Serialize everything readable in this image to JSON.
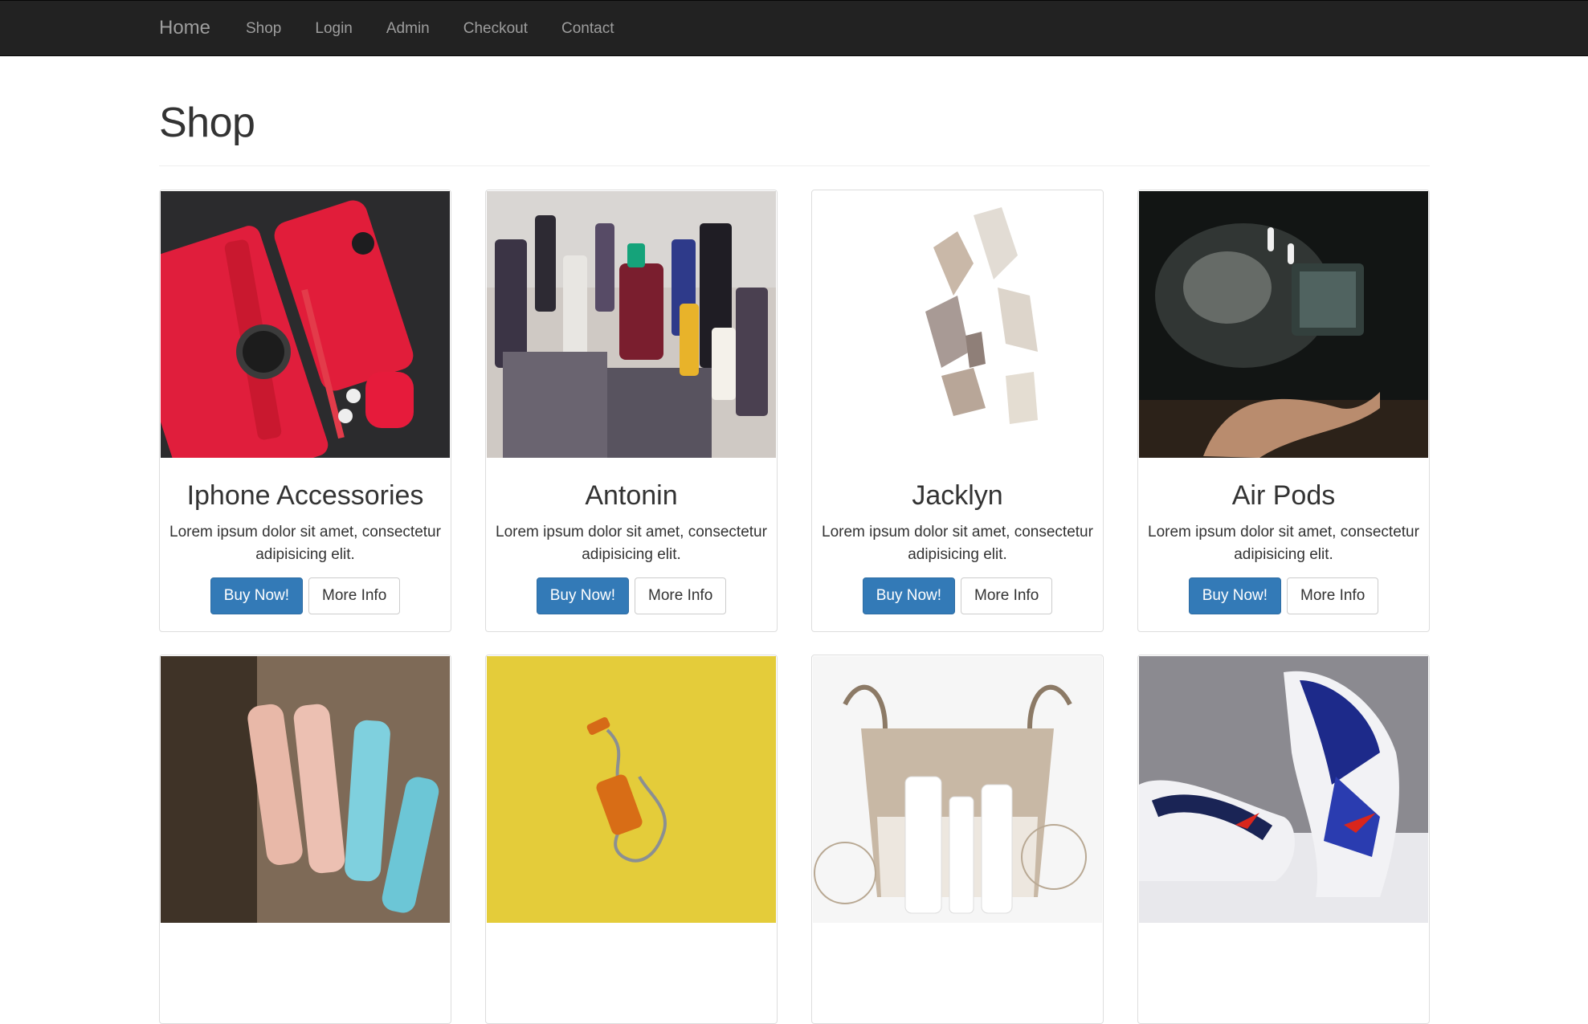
{
  "nav": {
    "brand": "Home",
    "links": [
      "Shop",
      "Login",
      "Admin",
      "Checkout",
      "Contact"
    ]
  },
  "page": {
    "title": "Shop"
  },
  "products": [
    {
      "name": "Iphone Accessories",
      "description": "Lorem ipsum dolor sit amet, consectetur adipisicing elit.",
      "buy_label": "Buy Now!",
      "info_label": "More Info",
      "image": "red-iphone-accessories-photo"
    },
    {
      "name": "Antonin",
      "description": "Lorem ipsum dolor sit amet, consectetur adipisicing elit.",
      "buy_label": "Buy Now!",
      "info_label": "More Info",
      "image": "cosmetics-bottles-photo"
    },
    {
      "name": "Jacklyn",
      "description": "Lorem ipsum dolor sit amet, consectetur adipisicing elit.",
      "buy_label": "Buy Now!",
      "info_label": "More Info",
      "image": "high-heel-shoes-photo"
    },
    {
      "name": "Air Pods",
      "description": "Lorem ipsum dolor sit amet, consectetur adipisicing elit.",
      "buy_label": "Buy Now!",
      "info_label": "More Info",
      "image": "airpods-floating-hand-photo"
    }
  ],
  "products_row2": [
    {
      "image": "hair-care-bottles-photo"
    },
    {
      "image": "orange-charger-yellow-photo"
    },
    {
      "image": "basket-skincare-photo"
    },
    {
      "image": "sneakers-photo"
    }
  ],
  "colors": {
    "navbar": "#222222",
    "primary": "#337ab7"
  }
}
